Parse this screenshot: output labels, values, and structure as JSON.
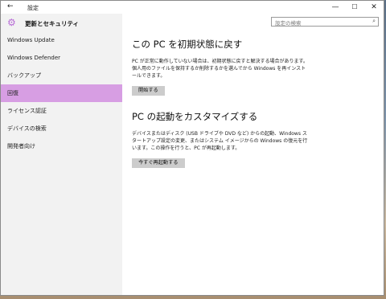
{
  "window": {
    "title": "設定",
    "back_glyph": "←",
    "minimize_glyph": "—",
    "maximize_glyph": "☐",
    "close_glyph": "✕"
  },
  "sidebar": {
    "header_icon": "gear-icon",
    "header_title": "更新とセキュリティ",
    "items": [
      {
        "label": "Windows Update",
        "selected": false
      },
      {
        "label": "Windows Defender",
        "selected": false
      },
      {
        "label": "バックアップ",
        "selected": false
      },
      {
        "label": "回復",
        "selected": true
      },
      {
        "label": "ライセンス認証",
        "selected": false
      },
      {
        "label": "デバイスの検索",
        "selected": false
      },
      {
        "label": "開発者向け",
        "selected": false
      }
    ]
  },
  "search": {
    "placeholder": "設定の検索",
    "icon": "search-icon"
  },
  "main": {
    "reset": {
      "heading": "この PC を初期状態に戻す",
      "description": "PC が正常に動作していない場合は、初期状態に戻すと解決する場合があります。個人用のファイルを保持するか削除するかを選んでから Windows を再インストールできます。",
      "button": "開始する"
    },
    "startup": {
      "heading": "PC の起動をカスタマイズする",
      "description": "デバイスまたはディスク (USB ドライブや DVD など) からの起動、Windows スタートアップ設定の変更、またはシステム イメージからの Windows の復元を行います。この操作を行うと、PC が再起動します。",
      "button": "今すぐ再起動する"
    }
  },
  "colors": {
    "accent": "#b76bd6",
    "selected_bg": "#d79ee3",
    "sidebar_bg": "#f2f2f2",
    "button_bg": "#cccccc"
  }
}
